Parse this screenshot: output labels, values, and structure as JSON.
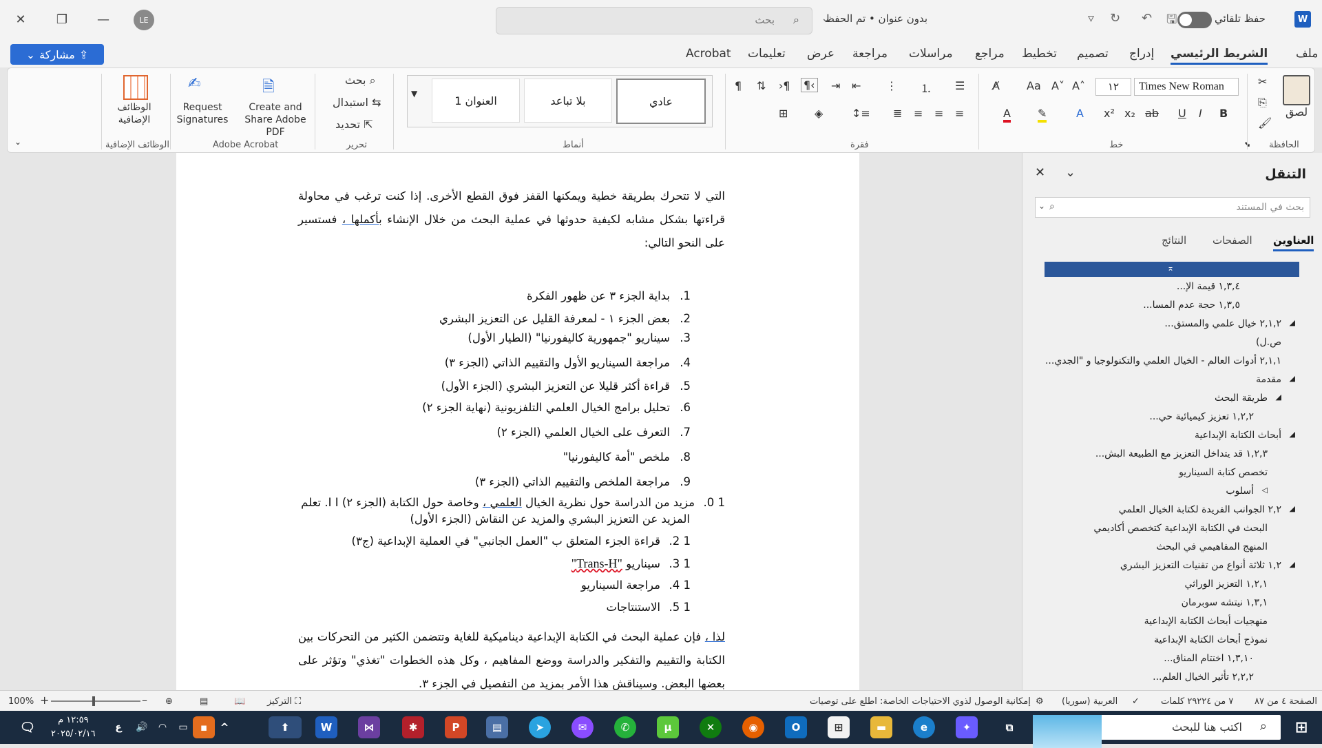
{
  "titlebar": {
    "doc_title": "بدون عنوان • تم الحفظ",
    "search_placeholder": "بحث",
    "autosave": "حفظ تلقائي",
    "avatar": "LE",
    "app": "W"
  },
  "menu": {
    "tabs": [
      "ملف",
      "الشريط الرئيسي",
      "إدراج",
      "تصميم",
      "تخطيط",
      "مراجع",
      "مراسلات",
      "مراجعة",
      "عرض",
      "تعليمات",
      "Acrobat"
    ],
    "active": "الشريط الرئيسي",
    "share": "مشاركة"
  },
  "ribbon": {
    "clipboard": {
      "paste": "لصق",
      "label": "الحافظة"
    },
    "font": {
      "name": "Times New Roman",
      "size": "١٢",
      "label": "خط"
    },
    "paragraph": {
      "label": "فقرة"
    },
    "styles": {
      "items": [
        "عادي",
        "بلا تباعد",
        "العنوان 1"
      ],
      "label": "أنماط"
    },
    "editing": {
      "find": "بحث",
      "replace": "استبدال",
      "select": "تحديد",
      "label": "تحرير"
    },
    "acrobat": {
      "create": "Create and Share Adobe PDF",
      "request": "Request Signatures",
      "label": "Adobe Acrobat"
    },
    "addins": {
      "button": "الوظائف الإضافية",
      "label": "الوظائف الإضافية"
    }
  },
  "document": {
    "para1_a": "التي لا تتحرك بطريقة خطية ويمكنها القفز فوق القطع الأخرى. إذا كنت ترغب في محاولة قراءتها بشكل مشابه لكيفية حدوثها في عملية البحث من خلال الإنشاء ",
    "para1_u": "بأكملها ،",
    "para1_b": " فستسير على النحو التالي:",
    "list": [
      {
        "n": "1.",
        "t": "بداية الجزء ٣ عن ظهور الفكرة"
      },
      {
        "n": "2.",
        "t": "بعض الجزء ١ - لمعرفة القليل عن التعزيز البشري"
      },
      {
        "n": "3.",
        "t": "سيناريو \"جمهورية كاليفورنيا\" (الطيار الأول)"
      },
      {
        "n": "4.",
        "t": "مراجعة السيناريو الأول والتقييم الذاتي (الجزء ٣)"
      },
      {
        "n": "5.",
        "t": "قراءة أكثر قليلا عن التعزيز البشري (الجزء الأول)"
      },
      {
        "n": "6.",
        "t": "تحليل برامج الخيال العلمي التلفزيونية (نهاية الجزء ٢)"
      },
      {
        "n": "7.",
        "t": "التعرف على الخيال العلمي (الجزء ٢)"
      },
      {
        "n": "8.",
        "t": "ملخص \"أمة كاليفورنيا\""
      },
      {
        "n": "9.",
        "t": "مراجعة الملخص والتقييم الذاتي (الجزء ٣)"
      }
    ],
    "item10_n": "1 0.",
    "item10_a": "مزيد من الدراسة حول نظرية الخيال ",
    "item10_u": "العلمي ،",
    "item10_b": " وخاصة حول الكتابة (الجزء ٢) I I. تعلم",
    "item10_c": "المزيد عن التعزيز البشري والمزيد عن النقاش (الجزء الأول)",
    "list2": [
      {
        "n": "1 2.",
        "t": "قراءة الجزء المتعلق ب \"العمل الجانبي\" في العملية الإبداعية (ج٣)"
      },
      {
        "n": "1 4.",
        "t": "مراجعة السيناريو"
      },
      {
        "n": "1 5.",
        "t": "الاستنتاجات"
      }
    ],
    "item13_n": "1 3.",
    "item13_a": "سيناريو ",
    "item13_b": "\"Trans-H\"",
    "para2_u": "لذا ،",
    "para2": " فإن عملية البحث في الكتابة الإبداعية ديناميكية للغاية وتتضمن الكثير من التحركات بين الكتابة والتقييم والتفكير والدراسة ووضع المفاهيم ، وكل هذه الخطوات \"تغذي\" وتؤثر على بعضها البعض. وسيناقش هذا الأمر بمزيد من التفصيل في الجزء ٣."
  },
  "nav": {
    "title": "التنقل",
    "search_placeholder": "بحث في المستند",
    "tabs": [
      "العناوين",
      "الصفحات",
      "النتائج"
    ],
    "items": [
      "١,٣,٤ قيمة الإ...",
      "١,٣,٥ حجة عدم المسا...",
      "٢,١,٢ خيال علمي والمستق...",
      "ص.ل)",
      "٢,١,١ أدوات العالم - الخيال العلمي والتكنولوجيا و \"الجدي...",
      "مقدمة",
      "طريقة البحث",
      "١,٢,٢ تعزيز كيميائية حي...",
      "أبحاث الكتابة الإبداعية",
      "١,٢,٣ قد يتداخل التعزيز مع الطبيعة البش...",
      "تخصص كتابة السيناريو",
      "أسلوب",
      "٢,٢ الجوانب الفريدة لكتابة الخيال العلمي",
      "البحث في الكتابة الإبداعية كتخصص أكاديمي",
      "المنهج المفاهيمي في البحث",
      "١,٢ ثلاثة أنواع من تقنيات التعزيز البشري",
      "١,٢,١ التعزيز الوراثي",
      "١,٣,١ نيتشه سوبرمان",
      "منهجيات أبحاث الكتابة الإبداعية",
      "نموذج أبحاث الكتابة الإبداعية",
      "١,٣,١٠ اختتام المناق...",
      "٢,٢,٢ تأثير الخيال العلم..."
    ]
  },
  "status": {
    "page": "الصفحة ٤ من ٨٧",
    "words": "٧ من ٢٩٢٢٤ كلمات",
    "lang": "العربية (سوريا)",
    "access": "إمكانية الوصول لذوي الاحتياجات الخاصة: اطلع على توصيات",
    "focus": "التركيز",
    "zoom": "100%"
  },
  "taskbar": {
    "search": "اكتب هنا للبحث",
    "time": "١٢:٥٩ م",
    "date": "٢٠٢٥/٠٢/١٦",
    "lang": "ع"
  },
  "colors": {
    "accent": "#2b579a",
    "share": "#2b6cd4",
    "taskbar": "#1a2b3f"
  }
}
